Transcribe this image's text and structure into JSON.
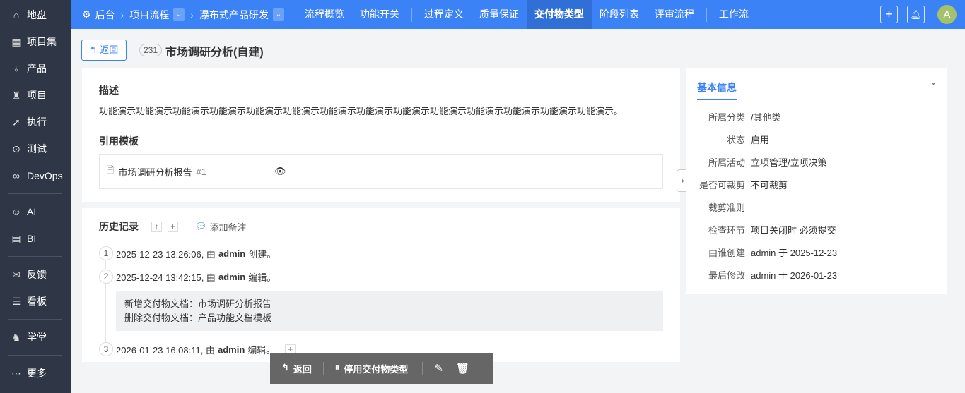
{
  "sidebar": {
    "items": [
      {
        "icon": "home-icon",
        "glyph": "⌂",
        "label": "地盘"
      },
      {
        "icon": "grid-icon",
        "glyph": "▦",
        "label": "项目集"
      },
      {
        "icon": "bulb-icon",
        "glyph": "♁",
        "label": "产品"
      },
      {
        "icon": "project-icon",
        "glyph": "♜",
        "label": "项目"
      },
      {
        "icon": "run-icon",
        "glyph": "➚",
        "label": "执行"
      },
      {
        "icon": "test-icon",
        "glyph": "⊙",
        "label": "测试"
      },
      {
        "icon": "infinity-icon",
        "glyph": "∞",
        "label": "DevOps"
      },
      {
        "icon": "robot-icon",
        "glyph": "☺",
        "label": "AI"
      },
      {
        "icon": "chart-icon",
        "glyph": "▤",
        "label": "BI"
      },
      {
        "icon": "feedback-icon",
        "glyph": "✉",
        "label": "反馈"
      },
      {
        "icon": "board-icon",
        "glyph": "☰",
        "label": "看板"
      },
      {
        "icon": "school-icon",
        "glyph": "♞",
        "label": "学堂"
      },
      {
        "icon": "more-icon",
        "glyph": "⋯",
        "label": "更多"
      }
    ]
  },
  "topbar": {
    "crumbs": [
      "后台",
      "项目流程",
      "瀑布式产品研发"
    ],
    "nav": [
      "流程概览",
      "功能开关",
      "过程定义",
      "质量保证",
      "交付物类型",
      "阶段列表",
      "评审流程",
      "工作流"
    ],
    "active": "交付物类型",
    "avatar": "A"
  },
  "header": {
    "back": "返回",
    "id": "231",
    "title": "市场调研分析(自建)"
  },
  "desc": {
    "title": "描述",
    "text": "功能演示功能演示功能演示功能演示功能演示功能演示功能演示功能演示功能演示功能演示功能演示功能演示功能演示功能演示。"
  },
  "template": {
    "title": "引用模板",
    "name": "市场调研分析报告",
    "num": "#1"
  },
  "history": {
    "title": "历史记录",
    "add_note": "添加备注",
    "entries": [
      {
        "n": "1",
        "time": "2025-12-23 13:26:06, 由",
        "user": "admin",
        "action": "创建。"
      },
      {
        "n": "2",
        "time": "2025-12-24 13:42:15, 由",
        "user": "admin",
        "action": "编辑。",
        "details": [
          "新增交付物文档：市场调研分析报告",
          "删除交付物文档：产品功能文档模板"
        ]
      },
      {
        "n": "3",
        "time": "2026-01-23 16:08:11, 由",
        "user": "admin",
        "action": "编辑。"
      }
    ]
  },
  "basic": {
    "title": "基本信息",
    "rows": [
      {
        "k": "所属分类",
        "v": "/其他类"
      },
      {
        "k": "状态",
        "v": "启用"
      },
      {
        "k": "所属活动",
        "v": "立项管理/立项决策"
      },
      {
        "k": "是否可裁剪",
        "v": "不可裁剪"
      },
      {
        "k": "裁剪准则",
        "v": ""
      },
      {
        "k": "检查环节",
        "v": "项目关闭时 必须提交"
      },
      {
        "k": "由谁创建",
        "v": "admin 于 2025-12-23"
      },
      {
        "k": "最后修改",
        "v": "admin 于 2026-01-23"
      }
    ]
  },
  "actions": {
    "back": "返回",
    "disable": "停用交付物类型"
  }
}
